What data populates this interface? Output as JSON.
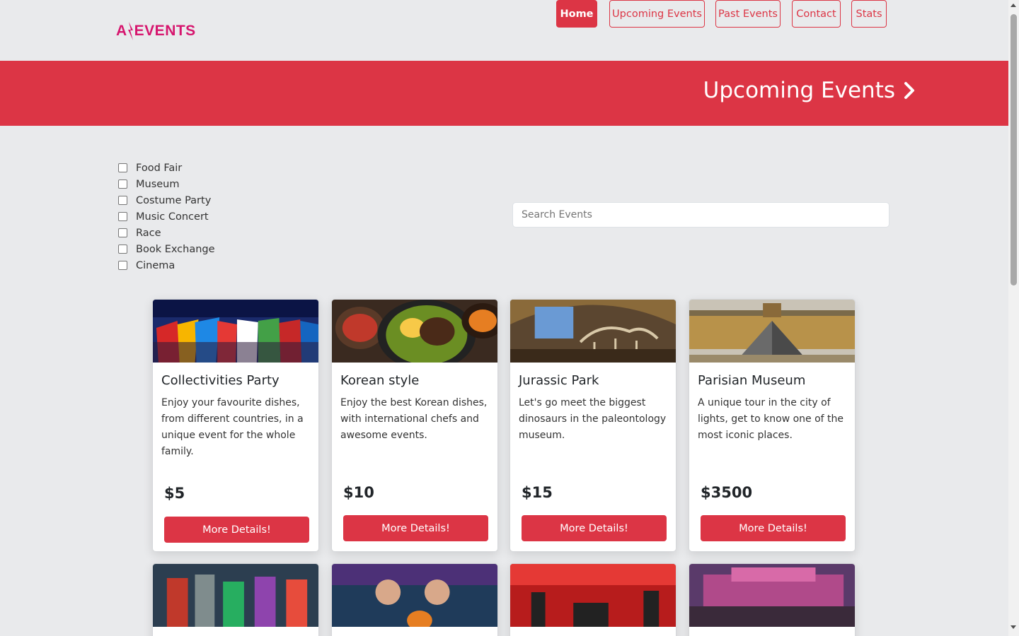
{
  "header": {
    "logo_text": "EVENTS",
    "logo_prefix": "A",
    "brand_color": "#d6166e",
    "nav": [
      {
        "label": "Home",
        "active": true
      },
      {
        "label": "Upcoming Events",
        "active": false
      },
      {
        "label": "Past Events",
        "active": false
      },
      {
        "label": "Contact",
        "active": false
      },
      {
        "label": "Stats",
        "active": false
      }
    ]
  },
  "banner": {
    "title": "Upcoming Events",
    "color": "#dc3545",
    "icon": "chevron-right-icon"
  },
  "filters": {
    "categories": [
      {
        "label": "Food Fair",
        "checked": false
      },
      {
        "label": "Museum",
        "checked": false
      },
      {
        "label": "Costume Party",
        "checked": false
      },
      {
        "label": "Music Concert",
        "checked": false
      },
      {
        "label": "Race",
        "checked": false
      },
      {
        "label": "Book Exchange",
        "checked": false
      },
      {
        "label": "Cinema",
        "checked": false
      }
    ]
  },
  "search": {
    "placeholder": "Search Events",
    "value": ""
  },
  "events": [
    {
      "title": "Collectivities Party",
      "description": "Enjoy your favourite dishes, from different countries, in a unique event for the whole family.",
      "price": "$5",
      "button": "More Details!",
      "image": "flags-festival-photo"
    },
    {
      "title": "Korean style",
      "description": "Enjoy the best Korean dishes, with international chefs and awesome events.",
      "price": "$10",
      "button": "More Details!",
      "image": "bibimbap-photo"
    },
    {
      "title": "Jurassic Park",
      "description": "Let's go meet the biggest dinosaurs in the paleontology museum.",
      "price": "$15",
      "button": "More Details!",
      "image": "dinosaur-museum-photo"
    },
    {
      "title": "Parisian Museum",
      "description": "A unique tour in the city of lights, get to know one of the most iconic places.",
      "price": "$3500",
      "button": "More Details!",
      "image": "louvre-photo"
    }
  ],
  "second_row_images": [
    "cosplay-photo",
    "halloween-party-photo",
    "rock-concert-photo",
    "festival-stage-photo"
  ]
}
